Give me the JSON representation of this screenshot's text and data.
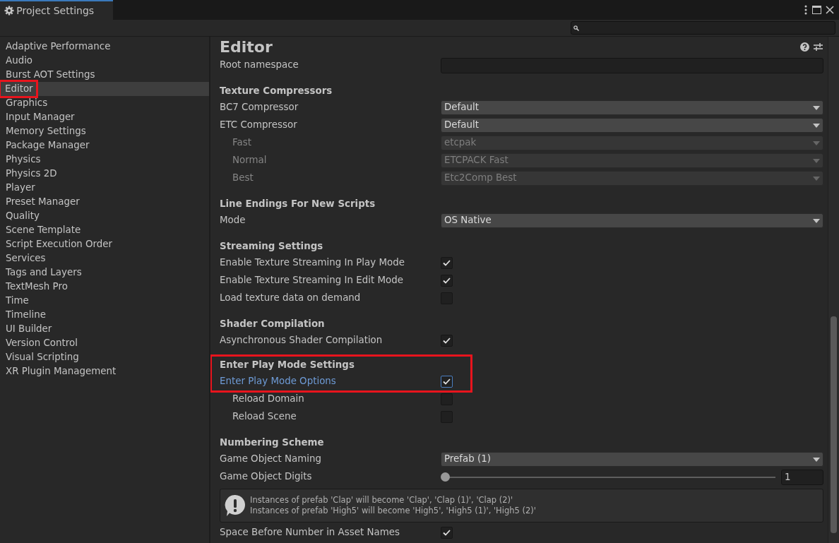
{
  "window": {
    "title": "Project Settings"
  },
  "sidebar": {
    "items": [
      {
        "label": "Adaptive Performance",
        "selected": false
      },
      {
        "label": "Audio",
        "selected": false
      },
      {
        "label": "Burst AOT Settings",
        "selected": false
      },
      {
        "label": "Editor",
        "selected": true,
        "highlighted": true
      },
      {
        "label": "Graphics",
        "selected": false
      },
      {
        "label": "Input Manager",
        "selected": false
      },
      {
        "label": "Memory Settings",
        "selected": false
      },
      {
        "label": "Package Manager",
        "selected": false
      },
      {
        "label": "Physics",
        "selected": false
      },
      {
        "label": "Physics 2D",
        "selected": false
      },
      {
        "label": "Player",
        "selected": false
      },
      {
        "label": "Preset Manager",
        "selected": false
      },
      {
        "label": "Quality",
        "selected": false
      },
      {
        "label": "Scene Template",
        "selected": false
      },
      {
        "label": "Script Execution Order",
        "selected": false
      },
      {
        "label": "Services",
        "selected": false
      },
      {
        "label": "Tags and Layers",
        "selected": false
      },
      {
        "label": "TextMesh Pro",
        "selected": false
      },
      {
        "label": "Time",
        "selected": false
      },
      {
        "label": "Timeline",
        "selected": false
      },
      {
        "label": "UI Builder",
        "selected": false
      },
      {
        "label": "Version Control",
        "selected": false
      },
      {
        "label": "Visual Scripting",
        "selected": false
      },
      {
        "label": "XR Plugin Management",
        "selected": false
      }
    ]
  },
  "panel": {
    "title": "Editor",
    "sections": [
      {
        "rows": [
          {
            "kind": "text",
            "label": "Root namespace"
          }
        ]
      },
      {
        "title": "Texture Compressors",
        "rows": [
          {
            "kind": "dropdown",
            "label": "BC7 Compressor",
            "value": "Default",
            "disabled": false
          },
          {
            "kind": "dropdown",
            "label": "ETC Compressor",
            "value": "Default",
            "disabled": false
          },
          {
            "kind": "dropdown",
            "label": "Fast",
            "value": "etcpak",
            "disabled": true,
            "indented": true
          },
          {
            "kind": "dropdown",
            "label": "Normal",
            "value": "ETCPACK Fast",
            "disabled": true,
            "indented": true
          },
          {
            "kind": "dropdown",
            "label": "Best",
            "value": "Etc2Comp Best",
            "disabled": true,
            "indented": true
          }
        ]
      },
      {
        "title": "Line Endings For New Scripts",
        "rows": [
          {
            "kind": "dropdown",
            "label": "Mode",
            "value": "OS Native",
            "disabled": false
          }
        ]
      },
      {
        "title": "Streaming Settings",
        "rows": [
          {
            "kind": "checkbox",
            "label": "Enable Texture Streaming In Play Mode",
            "checked": true
          },
          {
            "kind": "checkbox",
            "label": "Enable Texture Streaming In Edit Mode",
            "checked": true
          },
          {
            "kind": "checkbox",
            "label": "Load texture data on demand",
            "checked": false
          }
        ]
      },
      {
        "title": "Shader Compilation",
        "rows": [
          {
            "kind": "checkbox",
            "label": "Asynchronous Shader Compilation",
            "checked": true
          }
        ]
      },
      {
        "title": "Enter Play Mode Settings",
        "highlighted": true,
        "rows": [
          {
            "kind": "checkbox",
            "label": "Enter Play Mode Options",
            "checked": true,
            "focused": true
          },
          {
            "kind": "checkbox",
            "label": "Reload Domain",
            "checked": false,
            "indented": true
          },
          {
            "kind": "checkbox",
            "label": "Reload Scene",
            "checked": false,
            "indented": true
          }
        ]
      },
      {
        "title": "Numbering Scheme",
        "rows": [
          {
            "kind": "dropdown",
            "label": "Game Object Naming",
            "value": "Prefab (1)",
            "disabled": false
          },
          {
            "kind": "slider",
            "label": "Game Object Digits",
            "level": 0,
            "value": "1"
          },
          {
            "kind": "help",
            "lines": [
              "Instances of prefab 'Clap' will become 'Clap', 'Clap (1)', 'Clap (2)'",
              "Instances of prefab 'High5' will become 'High5', 'High5 (1)', 'High5 (2)'"
            ]
          },
          {
            "kind": "checkbox",
            "label": "Space Before Number in Asset Names",
            "checked": true
          }
        ]
      }
    ]
  }
}
